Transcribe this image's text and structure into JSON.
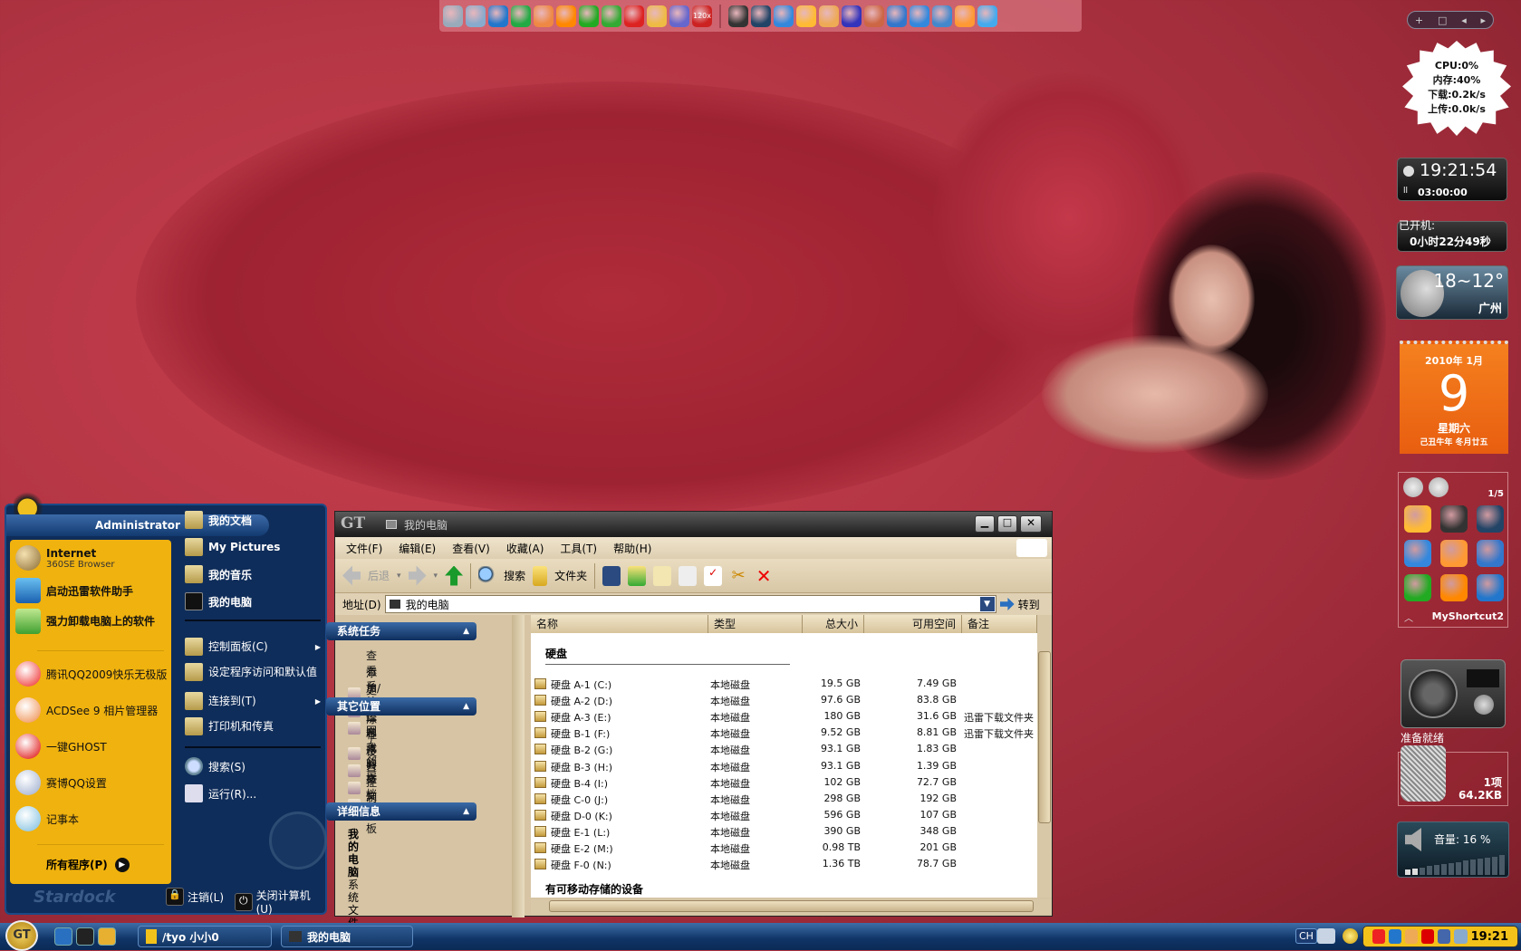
{
  "quick_dock": {
    "icons": [
      "monitor-icon",
      "search-doc-icon",
      "ie-icon",
      "360-browser-icon",
      "firefox-icon",
      "thunder-icon",
      "raysource-icon",
      "qq-pet-icon",
      "ruby-icon",
      "music-icon",
      "hp-icon",
      "acrobat-icon",
      "snapshot-icon",
      "kmplayer-icon",
      "arrow-app-icon",
      "video-icon",
      "media-icon",
      "tool-icon",
      "paint-icon",
      "thunder-bird-icon",
      "messenger-icon",
      "fan-icon",
      "qq-group-icon",
      "qq-icon"
    ],
    "badge_120x": "120x"
  },
  "start_menu": {
    "user": "Administrator",
    "pinned": [
      {
        "title": "Internet",
        "subtitle": "360SE Browser",
        "icon": "globe-icon"
      },
      {
        "title": "启动迅雷软件助手",
        "icon": "thunder-icon"
      },
      {
        "title": "强力卸载电脑上的软件",
        "icon": "uninstall-icon"
      }
    ],
    "recent": [
      {
        "title": "腾讯QQ2009快乐无极版",
        "icon": "qq-icon"
      },
      {
        "title": "ACDSee 9 相片管理器",
        "icon": "camera-icon"
      },
      {
        "title": "一键GHOST",
        "icon": "ghost-icon"
      },
      {
        "title": "赛博QQ设置",
        "icon": "gear-icon"
      },
      {
        "title": "记事本",
        "icon": "notepad-icon"
      }
    ],
    "all_programs": "所有程序(P)",
    "places": [
      "我的文档",
      "My Pictures",
      "我的音乐",
      "我的电脑"
    ],
    "system": [
      {
        "title": "控制面板(C)",
        "arrow": true
      },
      {
        "title": "设定程序访问和默认值"
      },
      {
        "title": "连接到(T)",
        "arrow": true
      },
      {
        "title": "打印机和传真"
      }
    ],
    "tools": [
      "搜索(S)",
      "运行(R)..."
    ],
    "logoff": "注销(L)",
    "shutdown": "关闭计算机(U)",
    "brand": "Stardock"
  },
  "explorer": {
    "title": "我的电脑",
    "logo": "GT",
    "menu": [
      "文件(F)",
      "编辑(E)",
      "查看(V)",
      "收藏(A)",
      "工具(T)",
      "帮助(H)"
    ],
    "toolbar": {
      "back": "后退",
      "search": "搜索",
      "folders": "文件夹"
    },
    "address_label": "地址(D)",
    "address_value": "我的电脑",
    "go": "转到",
    "panels": [
      {
        "title": "系统任务",
        "items": [
          "查看系统信息",
          "添加/删除程序",
          "更改一个设置"
        ]
      },
      {
        "title": "其它位置",
        "items": [
          "网上邻居",
          "我的文档",
          "共享文档",
          "控制面板"
        ]
      },
      {
        "title": "详细信息",
        "name": "我的电脑",
        "desc": "系统文件夹"
      }
    ],
    "columns": [
      "名称",
      "类型",
      "总大小",
      "可用空间",
      "备注"
    ],
    "group_hdd": "硬盘",
    "drives": [
      {
        "name": "硬盘 A-1 (C:)",
        "type": "本地磁盘",
        "total": "19.5 GB",
        "free": "7.49 GB",
        "note": ""
      },
      {
        "name": "硬盘 A-2 (D:)",
        "type": "本地磁盘",
        "total": "97.6 GB",
        "free": "83.8 GB",
        "note": ""
      },
      {
        "name": "硬盘 A-3 (E:)",
        "type": "本地磁盘",
        "total": "180 GB",
        "free": "31.6 GB",
        "note": "迅雷下载文件夹"
      },
      {
        "name": "硬盘 B-1 (F:)",
        "type": "本地磁盘",
        "total": "9.52 GB",
        "free": "8.81 GB",
        "note": "迅雷下载文件夹"
      },
      {
        "name": "硬盘 B-2 (G:)",
        "type": "本地磁盘",
        "total": "93.1 GB",
        "free": "1.83 GB",
        "note": ""
      },
      {
        "name": "硬盘 B-3 (H:)",
        "type": "本地磁盘",
        "total": "93.1 GB",
        "free": "1.39 GB",
        "note": ""
      },
      {
        "name": "硬盘 B-4 (I:)",
        "type": "本地磁盘",
        "total": "102 GB",
        "free": "72.7 GB",
        "note": ""
      },
      {
        "name": "硬盘 C-0 (J:)",
        "type": "本地磁盘",
        "total": "298 GB",
        "free": "192 GB",
        "note": ""
      },
      {
        "name": "硬盘 D-0 (K:)",
        "type": "本地磁盘",
        "total": "596 GB",
        "free": "107 GB",
        "note": ""
      },
      {
        "name": "硬盘 E-1 (L:)",
        "type": "本地磁盘",
        "total": "390 GB",
        "free": "348 GB",
        "note": ""
      },
      {
        "name": "硬盘 E-2 (M:)",
        "type": "本地磁盘",
        "total": "0.98 TB",
        "free": "201 GB",
        "note": ""
      },
      {
        "name": "硬盘 F-0 (N:)",
        "type": "本地磁盘",
        "total": "1.36 TB",
        "free": "78.7 GB",
        "note": ""
      }
    ],
    "group_removable": "有可移动存储的设备"
  },
  "widgets": {
    "sysmon": {
      "cpu": "CPU:0%",
      "mem": "内存:40%",
      "down": "下载:0.2k/s",
      "up": "上传:0.0k/s"
    },
    "clock": {
      "time": "19:21:54",
      "timer": "03:00:00"
    },
    "uptime": {
      "label": "已开机:",
      "value": "0小时22分49秒"
    },
    "weather": {
      "temp": "18~12°",
      "city": "广州"
    },
    "calendar": {
      "year_month": "2010年 1月",
      "day": "9",
      "weekday": "星期六",
      "lunar": "己丑牛年 冬月廿五"
    },
    "shortcuts": {
      "page": "1/5",
      "name": "MyShortcut2",
      "icons": [
        "video-icon",
        "snapshot-icon",
        "kmplayer-icon",
        "qq-blue-icon",
        "messenger-icon",
        "thunder-bird-icon",
        "raysource-icon",
        "thunder-icon",
        "arrow-app-icon"
      ]
    },
    "radio": {
      "status": "准备就绪"
    },
    "recycle": {
      "count": "1项",
      "size": "64.2KB"
    },
    "volume": {
      "label": "音量: 16 %",
      "level": 16
    }
  },
  "taskbar": {
    "tasks": [
      {
        "title": "/tyo 小小0"
      },
      {
        "title": "我的电脑"
      }
    ],
    "lang": "CH",
    "clock": "19:21",
    "tray_icons": [
      "qq-icon",
      "ie-icon",
      "network-icon",
      "ati-icon",
      "display-icon",
      "media-icon"
    ]
  },
  "colors": {
    "start_left": "#f0b20e",
    "start_right": "#0f2d5a",
    "explorer_bg": "#d6c4a4",
    "calendar": "#f0701a",
    "tray": "#f3c21a"
  }
}
